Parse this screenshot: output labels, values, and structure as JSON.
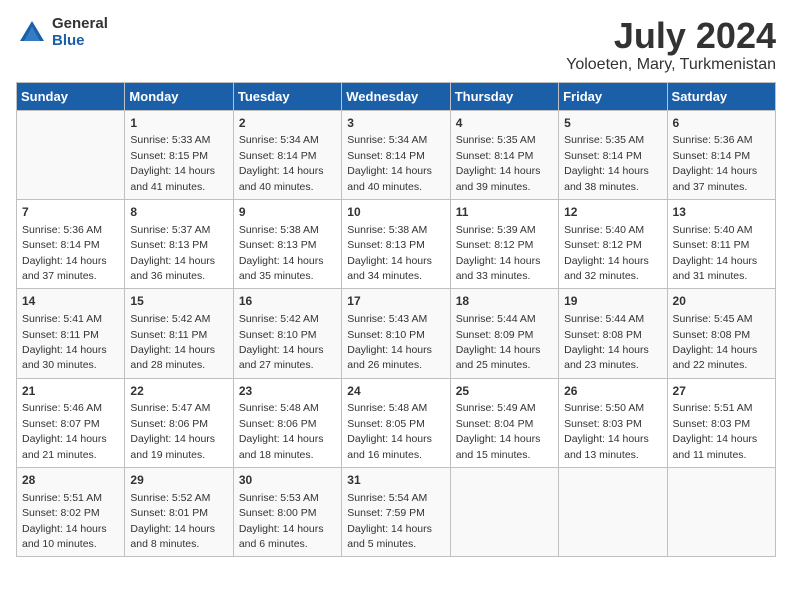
{
  "logo": {
    "general": "General",
    "blue": "Blue"
  },
  "title": {
    "month": "July 2024",
    "location": "Yoloeten, Mary, Turkmenistan"
  },
  "headers": [
    "Sunday",
    "Monday",
    "Tuesday",
    "Wednesday",
    "Thursday",
    "Friday",
    "Saturday"
  ],
  "weeks": [
    [
      {
        "day": "",
        "info": ""
      },
      {
        "day": "1",
        "info": "Sunrise: 5:33 AM\nSunset: 8:15 PM\nDaylight: 14 hours\nand 41 minutes."
      },
      {
        "day": "2",
        "info": "Sunrise: 5:34 AM\nSunset: 8:14 PM\nDaylight: 14 hours\nand 40 minutes."
      },
      {
        "day": "3",
        "info": "Sunrise: 5:34 AM\nSunset: 8:14 PM\nDaylight: 14 hours\nand 40 minutes."
      },
      {
        "day": "4",
        "info": "Sunrise: 5:35 AM\nSunset: 8:14 PM\nDaylight: 14 hours\nand 39 minutes."
      },
      {
        "day": "5",
        "info": "Sunrise: 5:35 AM\nSunset: 8:14 PM\nDaylight: 14 hours\nand 38 minutes."
      },
      {
        "day": "6",
        "info": "Sunrise: 5:36 AM\nSunset: 8:14 PM\nDaylight: 14 hours\nand 37 minutes."
      }
    ],
    [
      {
        "day": "7",
        "info": "Sunrise: 5:36 AM\nSunset: 8:14 PM\nDaylight: 14 hours\nand 37 minutes."
      },
      {
        "day": "8",
        "info": "Sunrise: 5:37 AM\nSunset: 8:13 PM\nDaylight: 14 hours\nand 36 minutes."
      },
      {
        "day": "9",
        "info": "Sunrise: 5:38 AM\nSunset: 8:13 PM\nDaylight: 14 hours\nand 35 minutes."
      },
      {
        "day": "10",
        "info": "Sunrise: 5:38 AM\nSunset: 8:13 PM\nDaylight: 14 hours\nand 34 minutes."
      },
      {
        "day": "11",
        "info": "Sunrise: 5:39 AM\nSunset: 8:12 PM\nDaylight: 14 hours\nand 33 minutes."
      },
      {
        "day": "12",
        "info": "Sunrise: 5:40 AM\nSunset: 8:12 PM\nDaylight: 14 hours\nand 32 minutes."
      },
      {
        "day": "13",
        "info": "Sunrise: 5:40 AM\nSunset: 8:11 PM\nDaylight: 14 hours\nand 31 minutes."
      }
    ],
    [
      {
        "day": "14",
        "info": "Sunrise: 5:41 AM\nSunset: 8:11 PM\nDaylight: 14 hours\nand 30 minutes."
      },
      {
        "day": "15",
        "info": "Sunrise: 5:42 AM\nSunset: 8:11 PM\nDaylight: 14 hours\nand 28 minutes."
      },
      {
        "day": "16",
        "info": "Sunrise: 5:42 AM\nSunset: 8:10 PM\nDaylight: 14 hours\nand 27 minutes."
      },
      {
        "day": "17",
        "info": "Sunrise: 5:43 AM\nSunset: 8:10 PM\nDaylight: 14 hours\nand 26 minutes."
      },
      {
        "day": "18",
        "info": "Sunrise: 5:44 AM\nSunset: 8:09 PM\nDaylight: 14 hours\nand 25 minutes."
      },
      {
        "day": "19",
        "info": "Sunrise: 5:44 AM\nSunset: 8:08 PM\nDaylight: 14 hours\nand 23 minutes."
      },
      {
        "day": "20",
        "info": "Sunrise: 5:45 AM\nSunset: 8:08 PM\nDaylight: 14 hours\nand 22 minutes."
      }
    ],
    [
      {
        "day": "21",
        "info": "Sunrise: 5:46 AM\nSunset: 8:07 PM\nDaylight: 14 hours\nand 21 minutes."
      },
      {
        "day": "22",
        "info": "Sunrise: 5:47 AM\nSunset: 8:06 PM\nDaylight: 14 hours\nand 19 minutes."
      },
      {
        "day": "23",
        "info": "Sunrise: 5:48 AM\nSunset: 8:06 PM\nDaylight: 14 hours\nand 18 minutes."
      },
      {
        "day": "24",
        "info": "Sunrise: 5:48 AM\nSunset: 8:05 PM\nDaylight: 14 hours\nand 16 minutes."
      },
      {
        "day": "25",
        "info": "Sunrise: 5:49 AM\nSunset: 8:04 PM\nDaylight: 14 hours\nand 15 minutes."
      },
      {
        "day": "26",
        "info": "Sunrise: 5:50 AM\nSunset: 8:03 PM\nDaylight: 14 hours\nand 13 minutes."
      },
      {
        "day": "27",
        "info": "Sunrise: 5:51 AM\nSunset: 8:03 PM\nDaylight: 14 hours\nand 11 minutes."
      }
    ],
    [
      {
        "day": "28",
        "info": "Sunrise: 5:51 AM\nSunset: 8:02 PM\nDaylight: 14 hours\nand 10 minutes."
      },
      {
        "day": "29",
        "info": "Sunrise: 5:52 AM\nSunset: 8:01 PM\nDaylight: 14 hours\nand 8 minutes."
      },
      {
        "day": "30",
        "info": "Sunrise: 5:53 AM\nSunset: 8:00 PM\nDaylight: 14 hours\nand 6 minutes."
      },
      {
        "day": "31",
        "info": "Sunrise: 5:54 AM\nSunset: 7:59 PM\nDaylight: 14 hours\nand 5 minutes."
      },
      {
        "day": "",
        "info": ""
      },
      {
        "day": "",
        "info": ""
      },
      {
        "day": "",
        "info": ""
      }
    ]
  ]
}
